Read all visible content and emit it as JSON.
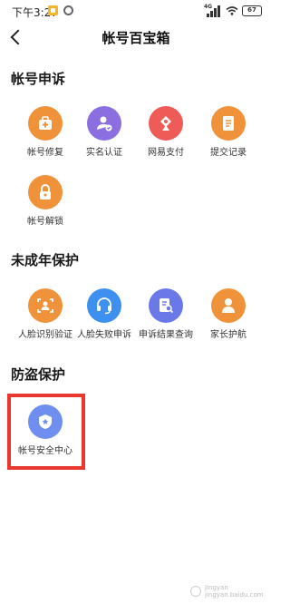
{
  "status_bar": {
    "time": "下午3:27",
    "network": "4G",
    "battery": "67"
  },
  "header": {
    "title": "帐号百宝箱"
  },
  "sections": [
    {
      "title": "帐号申诉",
      "items": [
        {
          "label": "帐号修复",
          "icon": "medkit-icon",
          "color": "#f0923a"
        },
        {
          "label": "实名认证",
          "icon": "user-verified-icon",
          "color": "#8b6fe0"
        },
        {
          "label": "网易支付",
          "icon": "payment-icon",
          "color": "#ef5b57"
        },
        {
          "label": "提交记录",
          "icon": "document-icon",
          "color": "#f0923a"
        },
        {
          "label": "帐号解锁",
          "icon": "lock-icon",
          "color": "#f0923a"
        }
      ]
    },
    {
      "title": "未成年保护",
      "items": [
        {
          "label": "人脸识别验证",
          "icon": "face-scan-icon",
          "color": "#f0923a"
        },
        {
          "label": "人脸失败申诉",
          "icon": "headset-icon",
          "color": "#3d8ff0"
        },
        {
          "label": "申诉结果查询",
          "icon": "search-doc-icon",
          "color": "#6b78e8"
        },
        {
          "label": "家长护航",
          "icon": "parent-icon",
          "color": "#f0923a"
        }
      ]
    },
    {
      "title": "防盗保护",
      "items": [
        {
          "label": "帐号安全中心",
          "icon": "shield-icon",
          "color": "#6f8ff0"
        }
      ]
    }
  ],
  "watermark": {
    "line1": "Jingyan",
    "line2": "jingyan.baidu.com"
  }
}
